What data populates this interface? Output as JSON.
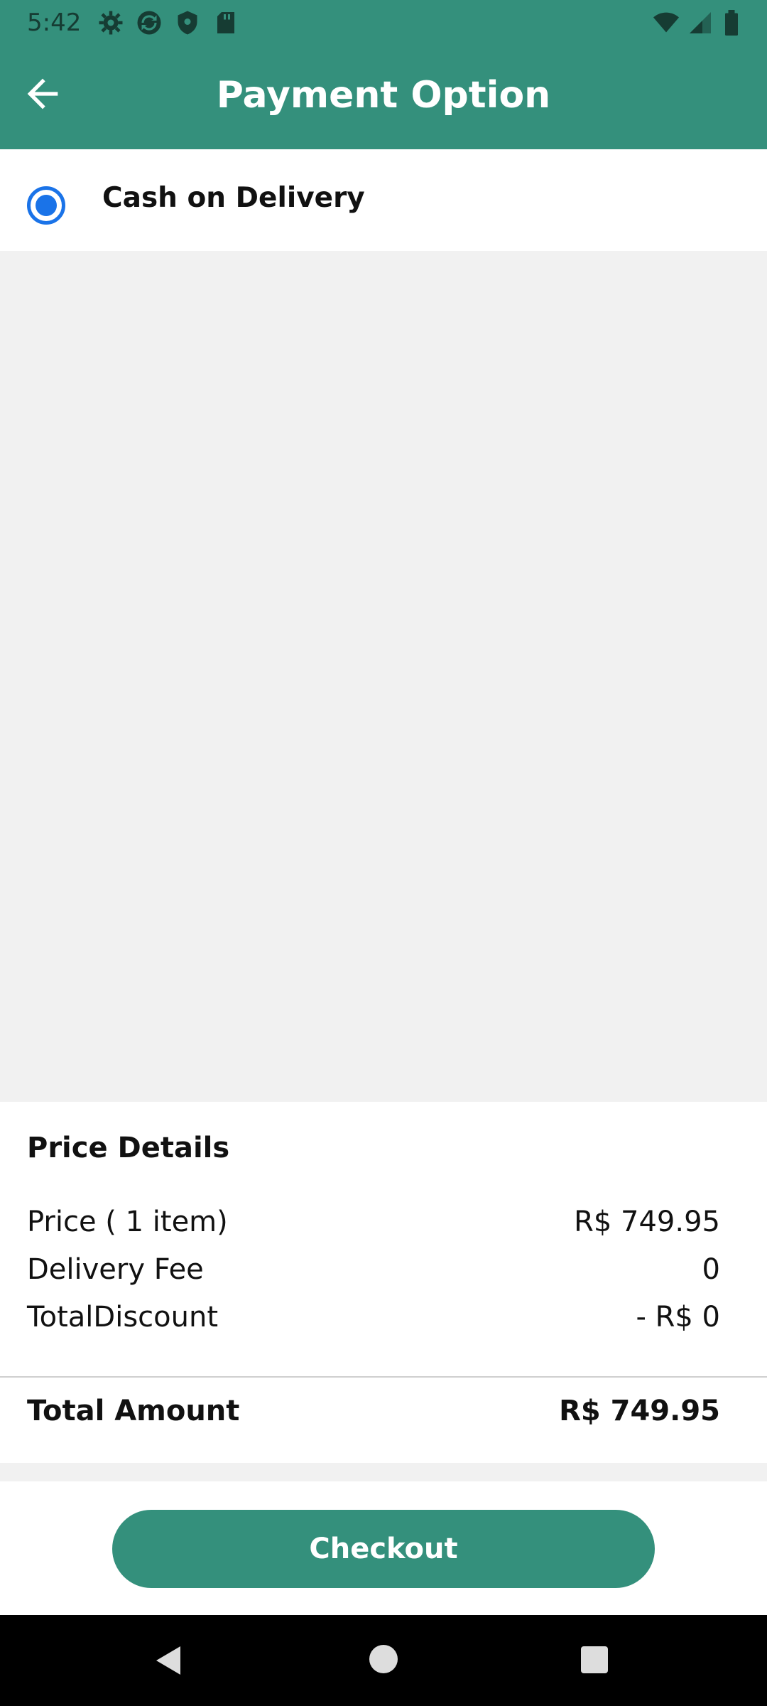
{
  "status_bar": {
    "time": "5:42",
    "icons": [
      "gear-icon",
      "sync-icon",
      "shield-icon",
      "sd-card-icon",
      "wifi-icon",
      "signal-icon",
      "battery-icon"
    ]
  },
  "app_bar": {
    "title": "Payment Option",
    "background_color": "#34907c"
  },
  "payment_options": [
    {
      "label": "Cash on Delivery",
      "selected": true
    }
  ],
  "price_details": {
    "heading": "Price Details",
    "rows": [
      {
        "label": "Price ( 1 item)",
        "value": "R$ 749.95"
      },
      {
        "label": "Delivery Fee",
        "value": "0"
      },
      {
        "label": "TotalDiscount",
        "value": "- R$ 0"
      }
    ],
    "total_label": "Total Amount",
    "total_value": "R$ 749.95"
  },
  "footer": {
    "checkout_label": "Checkout"
  },
  "colors": {
    "accent": "#34907c",
    "radio": "#1a73e8"
  }
}
